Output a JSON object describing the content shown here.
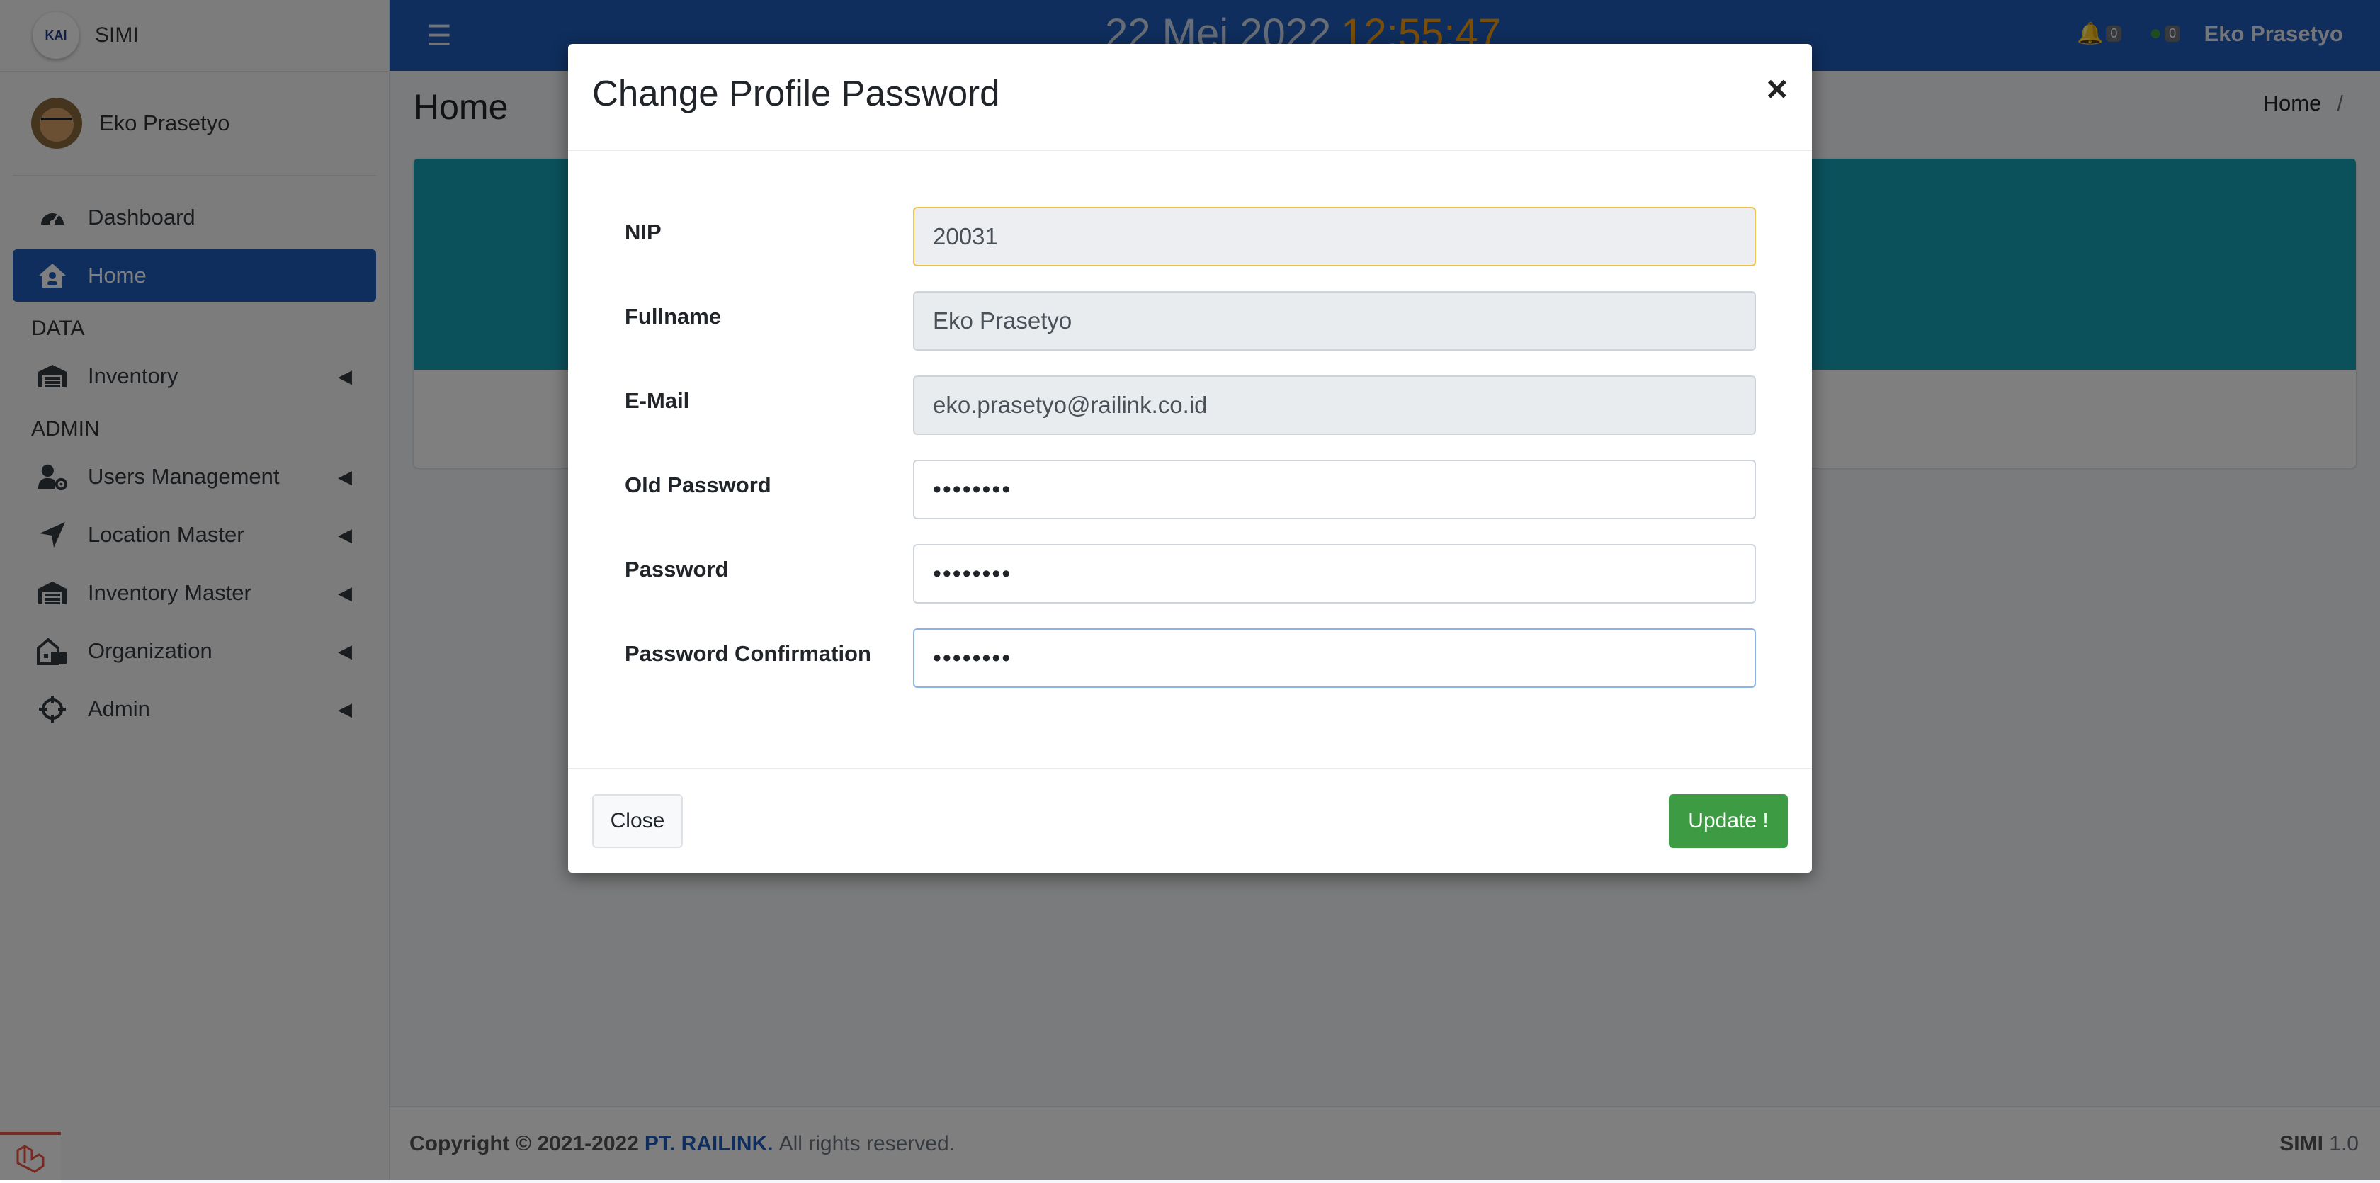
{
  "app": {
    "name": "SIMI",
    "logo_text": "KAI"
  },
  "user": {
    "name": "Eko Prasetyo"
  },
  "sidebar": {
    "items": [
      {
        "label": "Dashboard",
        "icon": "tachometer-icon",
        "active": false
      },
      {
        "label": "Home",
        "icon": "home-icon",
        "active": true
      }
    ],
    "sections": [
      {
        "header": "DATA",
        "items": [
          {
            "label": "Inventory",
            "icon": "warehouse-icon"
          }
        ]
      },
      {
        "header": "ADMIN",
        "items": [
          {
            "label": "Users Management",
            "icon": "users-cog-icon"
          },
          {
            "label": "Location Master",
            "icon": "location-arrow-icon"
          },
          {
            "label": "Inventory Master",
            "icon": "warehouse-icon"
          },
          {
            "label": "Organization",
            "icon": "building-icon"
          },
          {
            "label": "Admin",
            "icon": "crosshairs-icon"
          }
        ]
      }
    ]
  },
  "topbar": {
    "date": "22 Mei 2022",
    "time": "12:55:47",
    "notifications_count": "0",
    "messages_count": "0",
    "user_name": "Eko Prasetyo"
  },
  "content": {
    "title": "Home",
    "breadcrumb": [
      "Home",
      "/"
    ]
  },
  "modal": {
    "title": "Change Profile Password",
    "close_symbol": "×",
    "fields": [
      {
        "label": "NIP",
        "value": "20031",
        "state": "readonly-warning"
      },
      {
        "label": "Fullname",
        "value": "Eko Prasetyo",
        "state": "readonly"
      },
      {
        "label": "E-Mail",
        "value": "eko.prasetyo@railink.co.id",
        "state": "readonly"
      },
      {
        "label": "Old Password",
        "value": "••••••••",
        "state": "password"
      },
      {
        "label": "Password",
        "value": "••••••••",
        "state": "password"
      },
      {
        "label": "Password Confirmation",
        "value": "••••••••",
        "state": "password-focused"
      }
    ],
    "close_button": "Close",
    "update_button": "Update !"
  },
  "footer": {
    "copyright": "Copyright © 2021-2022",
    "company": "PT. RAILINK.",
    "rights": "All rights reserved.",
    "app_name": "SIMI",
    "version": "1.0"
  },
  "colors": {
    "primary": "#1f5dba",
    "info": "#17a2b8",
    "success": "#3d9b44",
    "clock_time": "#f39c12"
  }
}
